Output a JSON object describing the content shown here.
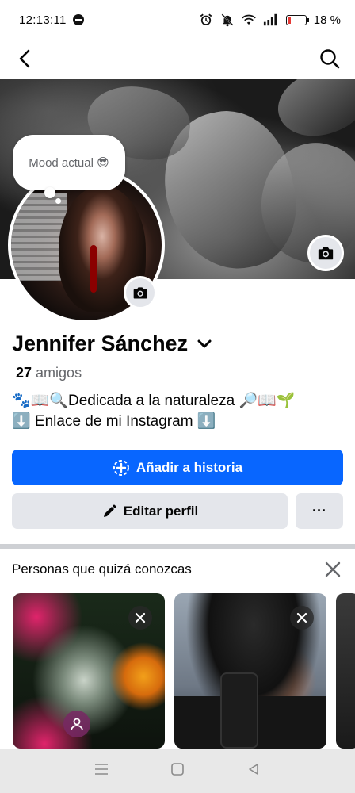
{
  "status_bar": {
    "time": "12:13:11",
    "battery_percent": "18 %",
    "battery_level": 0.18,
    "icons": [
      "do-not-disturb-icon",
      "alarm-icon",
      "muted-bell-icon",
      "wifi-icon",
      "signal-icon",
      "battery-icon"
    ]
  },
  "nav": {
    "back_icon": "back-arrow-icon",
    "search_icon": "search-icon"
  },
  "profile": {
    "mood": "Mood actual 😎",
    "name": "Jennifer Sánchez",
    "friends_count": "27",
    "friends_label": "amigos",
    "bio_line1": "🐾📖🔍Dedicada a la naturaleza 🔎📖🌱",
    "bio_line2": "⬇️ Enlace de mi Instagram ⬇️"
  },
  "buttons": {
    "add_story": "Añadir a historia",
    "edit_profile": "Editar perfil",
    "more": "···"
  },
  "pymk": {
    "title": "Personas que quizá conozcas"
  },
  "colors": {
    "primary": "#0866ff",
    "secondary_bg": "#e4e6eb",
    "text_secondary": "#65676b"
  }
}
